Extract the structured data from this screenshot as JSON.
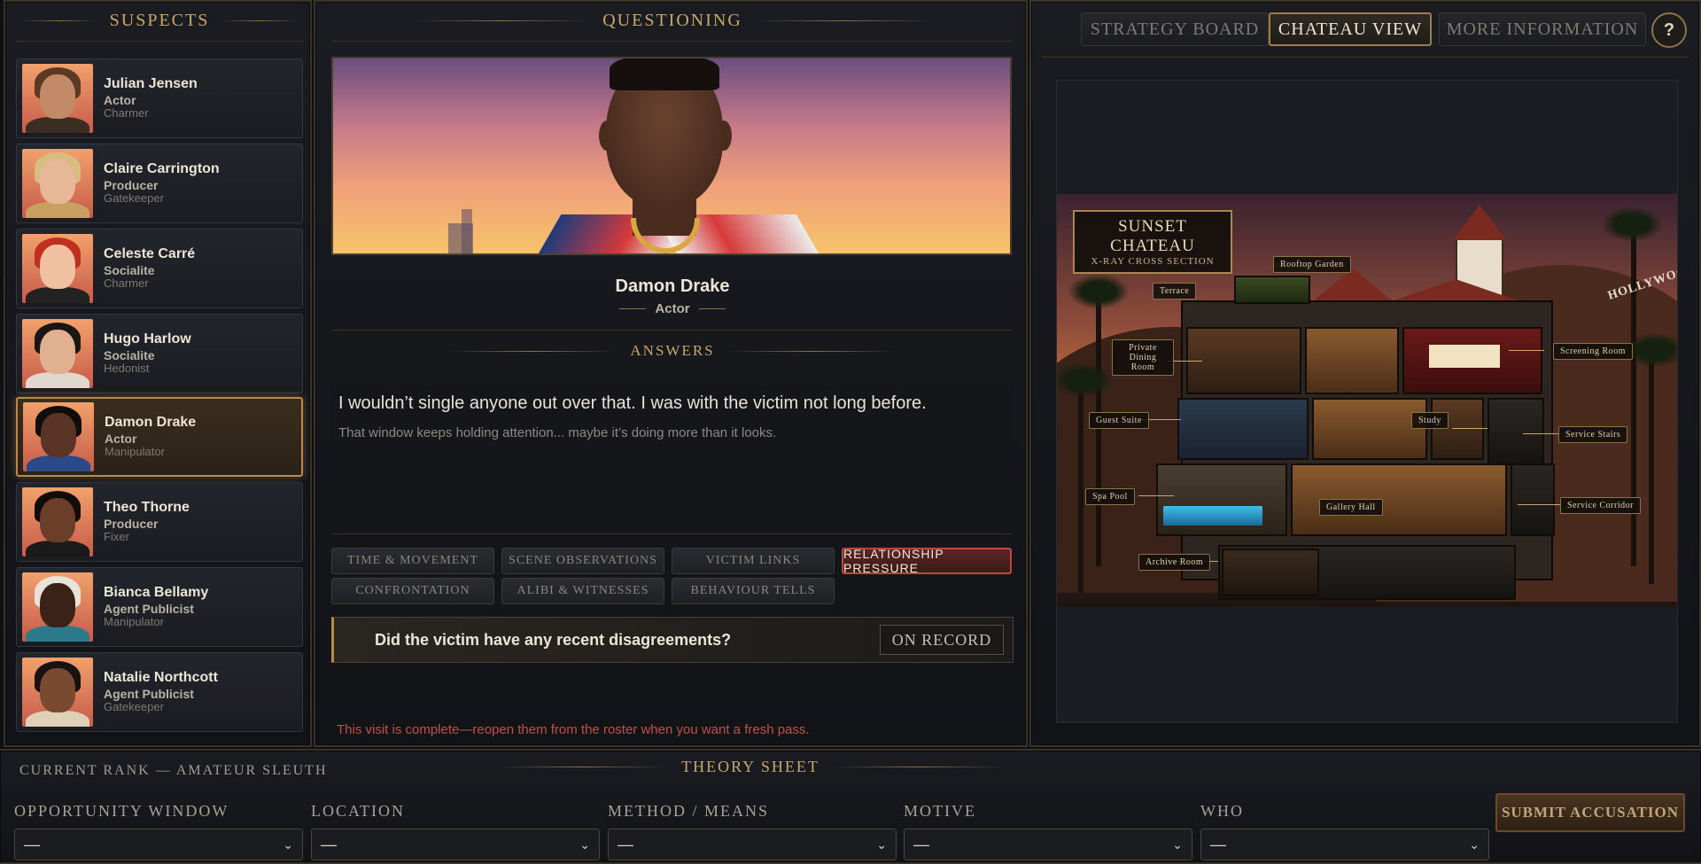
{
  "suspects_panel": {
    "title": "SUSPECTS"
  },
  "suspects": [
    {
      "name": "Julian Jensen",
      "role": "Actor",
      "trait": "Charmer",
      "hair": "#5a3a22",
      "skin": "#c28a66",
      "clothes": "#3a2e22"
    },
    {
      "name": "Claire Carrington",
      "role": "Producer",
      "trait": "Gatekeeper",
      "hair": "#d8bc82",
      "skin": "#e6b898",
      "clothes": "#c8a060"
    },
    {
      "name": "Celeste Carré",
      "role": "Socialite",
      "trait": "Charmer",
      "hair": "#c0301e",
      "skin": "#f0c0a0",
      "clothes": "#222"
    },
    {
      "name": "Hugo Harlow",
      "role": "Socialite",
      "trait": "Hedonist",
      "hair": "#1a1614",
      "skin": "#e0b090",
      "clothes": "#e0d8cc"
    },
    {
      "name": "Damon Drake",
      "role": "Actor",
      "trait": "Manipulator",
      "hair": "#120d0a",
      "skin": "#5a3424",
      "clothes": "#2a4a8a"
    },
    {
      "name": "Theo Thorne",
      "role": "Producer",
      "trait": "Fixer",
      "hair": "#120d0a",
      "skin": "#6a3e28",
      "clothes": "#1a1a1a"
    },
    {
      "name": "Bianca Bellamy",
      "role": "Agent Publicist",
      "trait": "Manipulator",
      "hair": "#e8e2d8",
      "skin": "#3a2218",
      "clothes": "#2a7a8a"
    },
    {
      "name": "Natalie Northcott",
      "role": "Agent Publicist",
      "trait": "Gatekeeper",
      "hair": "#1a1210",
      "skin": "#7a4a30",
      "clothes": "#e0d0b8"
    }
  ],
  "questioning": {
    "title": "QUESTIONING",
    "suspect_name": "Damon Drake",
    "suspect_role": "Actor",
    "answers_title": "ANSWERS",
    "answer_main": "I wouldn’t single anyone out over that. I was with the victim not long before.",
    "answer_sub": "That window keeps holding attention... maybe it’s doing more than it looks.",
    "tabs": [
      "TIME & MOVEMENT",
      "SCENE OBSERVATIONS",
      "VICTIM LINKS",
      "RELATIONSHIP PRESSURE",
      "CONFRONTATION",
      "ALIBI & WITNESSES",
      "BEHAVIOUR TELLS"
    ],
    "active_tab": "RELATIONSHIP PRESSURE",
    "question": "Did the victim have any recent disagreements?",
    "question_status": "ON RECORD",
    "visit_note": "This visit is complete—reopen them from the roster when you want a fresh pass."
  },
  "view_tabs": {
    "strategy": "STRATEGY BOARD",
    "chateau": "CHATEAU VIEW",
    "more": "MORE INFORMATION",
    "help": "?"
  },
  "map": {
    "title": "SUNSET CHATEAU",
    "subtitle": "X-RAY CROSS SECTION",
    "hollywood": "HOLLYWOOD",
    "rooms": {
      "rooftop_garden": "Rooftop Garden",
      "terrace": "Terrace",
      "private_dining": "Private Dining Room",
      "screening": "Screening Room",
      "guest_suite": "Guest Suite",
      "study": "Study",
      "service_stairs": "Service Stairs",
      "spa_pool": "Spa Pool",
      "gallery_hall": "Gallery Hall",
      "service_corridor": "Service Corridor",
      "archive": "Archive Room"
    }
  },
  "theory": {
    "title": "THEORY SHEET",
    "rank": "CURRENT RANK — AMATEUR SLEUTH",
    "fields": [
      {
        "label": "OPPORTUNITY WINDOW",
        "value": "—"
      },
      {
        "label": "LOCATION",
        "value": "—"
      },
      {
        "label": "METHOD / MEANS",
        "value": "—"
      },
      {
        "label": "MOTIVE",
        "value": "—"
      },
      {
        "label": "WHO",
        "value": "—"
      }
    ],
    "submit": "SUBMIT ACCUSATION"
  },
  "colors": {
    "accent_gold": "#c8a86b",
    "active_red": "#c0453f",
    "selected_border": "#b8894a"
  }
}
